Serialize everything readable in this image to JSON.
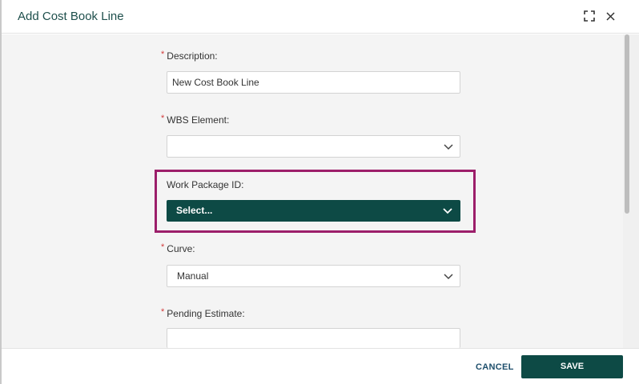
{
  "dialog": {
    "title": "Add Cost Book Line",
    "expand_icon": "expand-icon",
    "close_icon": "close-icon"
  },
  "form": {
    "required_marker": "*",
    "description": {
      "label": "Description:",
      "value": "New Cost Book Line",
      "required": true
    },
    "wbs_element": {
      "label": "WBS Element:",
      "value": "",
      "required": true
    },
    "work_package_id": {
      "label": "Work Package ID:",
      "value": "Select...",
      "required": false
    },
    "curve": {
      "label": "Curve:",
      "value": "Manual",
      "required": true
    },
    "pending_estimate": {
      "label": "Pending Estimate:",
      "value": "",
      "required": true
    }
  },
  "footer": {
    "cancel_label": "CANCEL",
    "save_label": "SAVE"
  },
  "colors": {
    "primary": "#0d4a45",
    "highlight": "#9c1e6a",
    "required": "#d23b3b"
  }
}
